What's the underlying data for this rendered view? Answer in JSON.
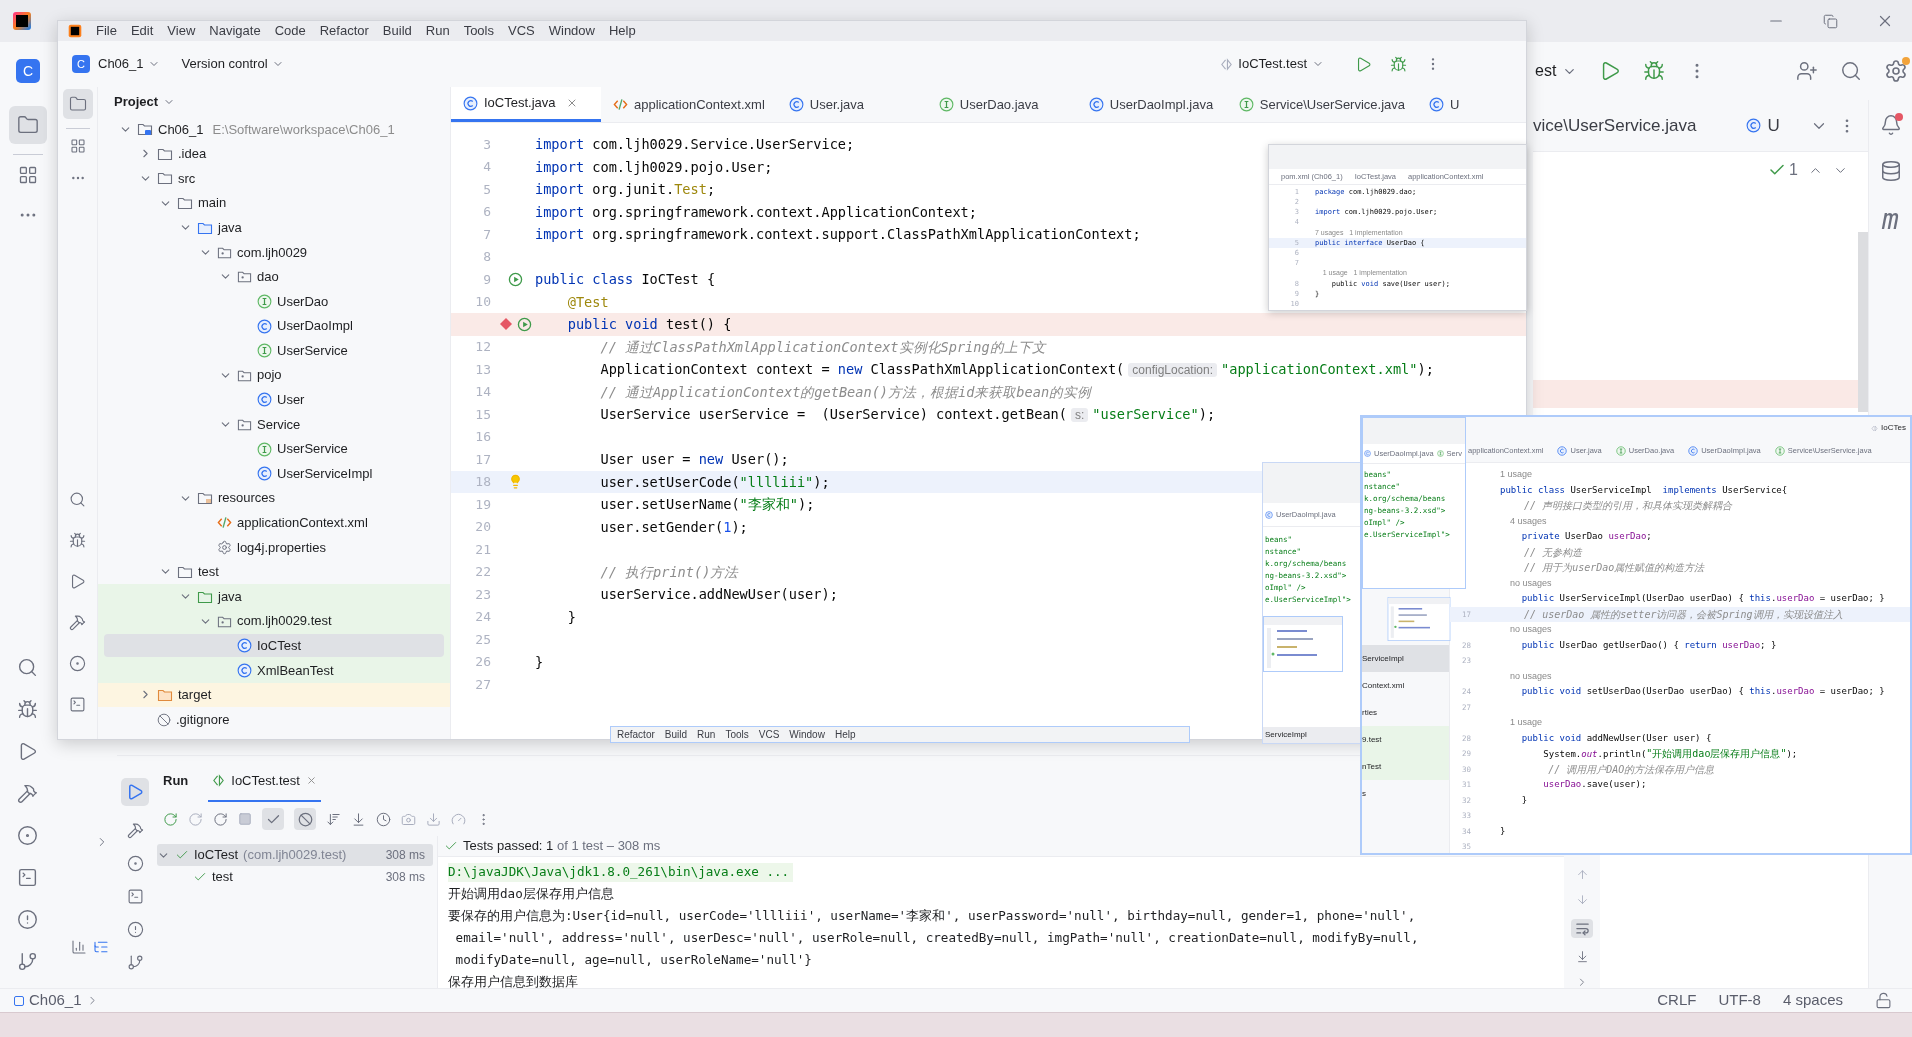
{
  "back_window": {
    "project_badge": "C",
    "run_config": "est",
    "tabs": [
      {
        "label": "vice\\UserService.java",
        "selected": false
      },
      {
        "label": "U",
        "kind": "class",
        "selected": false
      }
    ],
    "inspection_count": "1",
    "maven_label": "m",
    "status_bar": {
      "project": "Ch06_1",
      "items": [
        "CRLF",
        "UTF-8",
        "4 spaces"
      ]
    }
  },
  "run_panel": {
    "title": "Run",
    "tabs": [
      {
        "label": "IoCTest.test",
        "selected": true
      }
    ],
    "tests": [
      {
        "label": "IoCTest",
        "detail": "(com.ljh0029.test)",
        "time": "308 ms",
        "selected": true,
        "expanded": true,
        "children": [
          {
            "label": "test",
            "time": "308 ms",
            "selected": false
          }
        ]
      }
    ],
    "status": "**Tests passed: 1** of 1 test – 308 ms",
    "console": [
      {
        "kind": "command",
        "text": "D:\\javaJDK\\Java\\jdk1.8.0_261\\bin\\java.exe ..."
      },
      {
        "kind": "output",
        "text": "开始调用dao层保存用户信息"
      },
      {
        "kind": "output",
        "text": "要保存的用户信息为:User{id=null, userCode='lllliii', userName='李家和', userPassword='null', birthday=null, gender=1, phone='null',"
      },
      {
        "kind": "output",
        "text": " email='null', address='null', userDesc='null', userRole=null, createdBy=null, imgPath='null', creationDate=null, modifyBy=null,"
      },
      {
        "kind": "output",
        "text": " modifyDate=null, age=null, userRoleName='null'}"
      },
      {
        "kind": "output",
        "text": "保存用户信息到数据库"
      }
    ]
  },
  "front_window": {
    "menu": [
      "File",
      "Edit",
      "View",
      "Navigate",
      "Code",
      "Refactor",
      "Build",
      "Run",
      "Tools",
      "VCS",
      "Window",
      "Help"
    ],
    "project_badge": "C",
    "project": "Ch06_1",
    "vcs": "Version control",
    "run_config": "IoCTest.test",
    "panel_title": "Project",
    "tree": [
      {
        "label": "Ch06_1",
        "path": "E:\\Software\\workspace\\Ch06_1",
        "kind": "module",
        "expanded": true,
        "selected": false,
        "children": [
          {
            "label": ".idea",
            "kind": "folder",
            "expanded": false,
            "selected": false
          },
          {
            "label": "src",
            "kind": "folder",
            "expanded": true,
            "selected": false,
            "children": [
              {
                "label": "main",
                "kind": "folder",
                "expanded": true,
                "selected": false,
                "children": [
                  {
                    "label": "java",
                    "kind": "source_root",
                    "expanded": true,
                    "selected": false,
                    "children": [
                      {
                        "label": "com.ljh0029",
                        "kind": "package",
                        "expanded": true,
                        "selected": false,
                        "children": [
                          {
                            "label": "dao",
                            "kind": "package",
                            "expanded": true,
                            "selected": false,
                            "children": [
                              {
                                "label": "UserDao",
                                "kind": "interface",
                                "selected": false
                              },
                              {
                                "label": "UserDaoImpl",
                                "kind": "class",
                                "selected": false
                              },
                              {
                                "label": "UserService",
                                "kind": "interface",
                                "selected": false
                              }
                            ]
                          },
                          {
                            "label": "pojo",
                            "kind": "package",
                            "expanded": true,
                            "selected": false,
                            "children": [
                              {
                                "label": "User",
                                "kind": "class",
                                "selected": false
                              }
                            ]
                          },
                          {
                            "label": "Service",
                            "kind": "package",
                            "expanded": true,
                            "selected": false,
                            "children": [
                              {
                                "label": "UserService",
                                "kind": "interface",
                                "selected": false
                              },
                              {
                                "label": "UserServiceImpl",
                                "kind": "class",
                                "selected": false
                              }
                            ]
                          }
                        ]
                      }
                    ]
                  },
                  {
                    "label": "resources",
                    "kind": "resources",
                    "expanded": true,
                    "selected": false,
                    "children": [
                      {
                        "label": "applicationContext.xml",
                        "kind": "xml",
                        "selected": false
                      },
                      {
                        "label": "log4j.properties",
                        "kind": "properties",
                        "selected": false
                      }
                    ]
                  }
                ]
              },
              {
                "label": "test",
                "kind": "folder",
                "expanded": true,
                "selected": false,
                "children": [
                  {
                    "label": "java",
                    "kind": "test_root",
                    "expanded": true,
                    "selected": false,
                    "children": [
                      {
                        "label": "com.ljh0029.test",
                        "kind": "package",
                        "expanded": true,
                        "selected": false,
                        "children": [
                          {
                            "label": "IoCTest",
                            "kind": "class",
                            "selected": true
                          },
                          {
                            "label": "XmlBeanTest",
                            "kind": "class",
                            "selected": false
                          }
                        ]
                      }
                    ]
                  }
                ]
              }
            ]
          },
          {
            "label": "target",
            "kind": "excluded",
            "expanded": false,
            "selected": false
          },
          {
            "label": ".gitignore",
            "kind": "ignore",
            "selected": false
          }
        ]
      }
    ],
    "tabs": [
      {
        "label": "IoCTest.java",
        "kind": "class",
        "selected": true
      },
      {
        "label": "applicationContext.xml",
        "kind": "xml",
        "selected": false
      },
      {
        "label": "User.java",
        "kind": "class",
        "selected": false
      },
      {
        "label": "UserDao.java",
        "kind": "interface",
        "selected": false
      },
      {
        "label": "UserDaoImpl.java",
        "kind": "class",
        "selected": false
      },
      {
        "label": "Service\\UserService.java",
        "kind": "interface",
        "selected": false
      },
      {
        "label": "U",
        "kind": "class",
        "selected": false
      }
    ],
    "code": [
      {
        "n": "3",
        "segs": [
          {
            "kind": "kw",
            "text": "import"
          },
          {
            "kind": "pl",
            "text": " com.ljh0029.Service.UserService;"
          }
        ]
      },
      {
        "n": "4",
        "segs": [
          {
            "kind": "kw",
            "text": "import"
          },
          {
            "kind": "pl",
            "text": " com.ljh0029.pojo.User;"
          }
        ]
      },
      {
        "n": "5",
        "segs": [
          {
            "kind": "kw",
            "text": "import"
          },
          {
            "kind": "pl",
            "text": " org.junit."
          },
          {
            "kind": "ann",
            "text": "Test"
          },
          {
            "kind": "pl",
            "text": ";"
          }
        ]
      },
      {
        "n": "6",
        "segs": [
          {
            "kind": "kw",
            "text": "import"
          },
          {
            "kind": "pl",
            "text": " org.springframework.context.ApplicationContext;"
          }
        ]
      },
      {
        "n": "7",
        "segs": [
          {
            "kind": "kw",
            "text": "import"
          },
          {
            "kind": "pl",
            "text": " org.springframework.context.support.ClassPathXmlApplicationContext;"
          }
        ]
      },
      {
        "n": "8"
      },
      {
        "n": "9",
        "run_gutter": true,
        "segs": [
          {
            "kind": "kw",
            "text": "public class"
          },
          {
            "kind": "pl",
            "text": " IoCTest {"
          }
        ]
      },
      {
        "n": "10",
        "segs": [
          {
            "kind": "ann",
            "text": "    @Test"
          }
        ]
      },
      {
        "breakpoint": true,
        "run_gutter": true,
        "segs": [
          {
            "kind": "kw",
            "text": "    public void"
          },
          {
            "kind": "pl",
            "text": " test() {"
          }
        ]
      },
      {
        "n": "12",
        "segs": [
          {
            "kind": "com",
            "text": "        // 通过ClassPathXmlApplicationContext实例化Spring的上下文"
          }
        ]
      },
      {
        "n": "13",
        "segs": [
          {
            "kind": "pl",
            "text": "        ApplicationContext context = "
          },
          {
            "kind": "kw",
            "text": "new"
          },
          {
            "kind": "pl",
            "text": " ClassPathXmlApplicationContext("
          },
          {
            "kind": "hint",
            "text": "configLocation:"
          },
          {
            "kind": "str",
            "text": "\"applicationContext.xml\""
          },
          {
            "kind": "pl",
            "text": ");"
          }
        ]
      },
      {
        "n": "14",
        "segs": [
          {
            "kind": "com",
            "text": "        // 通过ApplicationContext的getBean()方法，根据id来获取bean的实例"
          }
        ]
      },
      {
        "n": "15",
        "segs": [
          {
            "kind": "pl",
            "text": "        UserService userService =  (UserService) context.getBean("
          },
          {
            "kind": "hint",
            "text": "s:"
          },
          {
            "kind": "str",
            "text": "\"userService\""
          },
          {
            "kind": "pl",
            "text": ");"
          }
        ]
      },
      {
        "n": "16"
      },
      {
        "n": "17",
        "segs": [
          {
            "kind": "pl",
            "text": "        User user = "
          },
          {
            "kind": "kw",
            "text": "new"
          },
          {
            "kind": "pl",
            "text": " User();"
          }
        ]
      },
      {
        "n": "18",
        "current": true,
        "bulb": true,
        "segs": [
          {
            "kind": "pl",
            "text": "        user.setUserCode("
          },
          {
            "kind": "str",
            "text": "\"lllliii\""
          },
          {
            "kind": "pl",
            "text": ");"
          }
        ]
      },
      {
        "n": "19",
        "segs": [
          {
            "kind": "pl",
            "text": "        user.setUserName("
          },
          {
            "kind": "str",
            "text": "\"李家和\""
          },
          {
            "kind": "pl",
            "text": ");"
          }
        ]
      },
      {
        "n": "20",
        "segs": [
          {
            "kind": "pl",
            "text": "        user.setGender("
          },
          {
            "kind": "num",
            "text": "1"
          },
          {
            "kind": "pl",
            "text": ");"
          }
        ]
      },
      {
        "n": "21"
      },
      {
        "n": "22",
        "segs": [
          {
            "kind": "com",
            "text": "        // 执行print()方法"
          }
        ]
      },
      {
        "n": "23",
        "segs": [
          {
            "kind": "pl",
            "text": "        userService.addNewUser(user);"
          }
        ]
      },
      {
        "n": "24",
        "segs": [
          {
            "kind": "pl",
            "text": "    }"
          }
        ]
      },
      {
        "n": "25"
      },
      {
        "n": "26",
        "segs": [
          {
            "kind": "pl",
            "text": "}"
          }
        ]
      },
      {
        "n": "27"
      }
    ]
  },
  "preview_popup": {
    "tabs": [
      "pom.xml (Ch06_1)",
      "IoCTest.java",
      "applicationContext.xml"
    ],
    "code": [
      {
        "n": "1",
        "segs": [
          {
            "kind": "kw",
            "text": "package"
          },
          {
            "kind": "pl",
            "text": " com.ljh0029.dao;"
          }
        ]
      },
      {
        "n": "2"
      },
      {
        "n": "3",
        "segs": [
          {
            "kind": "kw",
            "text": "import"
          },
          {
            "kind": "pl",
            "text": " com.ljh0029.pojo.User;"
          }
        ]
      },
      {
        "n": "4"
      },
      {
        "segs": [
          {
            "kind": "usage",
            "text": "7 usages   1 implementation"
          }
        ]
      },
      {
        "n": "5",
        "current": true,
        "segs": [
          {
            "kind": "kw",
            "text": "public interface"
          },
          {
            "kind": "pl",
            "text": " UserDao {"
          }
        ]
      },
      {
        "n": "6"
      },
      {
        "n": "7"
      },
      {
        "segs": [
          {
            "kind": "usage",
            "text": "    1 usage   1 implementation"
          }
        ]
      },
      {
        "n": "8",
        "segs": [
          {
            "kind": "pl",
            "text": "    public "
          },
          {
            "kind": "kw",
            "text": "void"
          },
          {
            "kind": "pl",
            "text": " save(User user);"
          }
        ]
      },
      {
        "n": "9",
        "segs": [
          {
            "kind": "pl",
            "text": "}"
          }
        ]
      },
      {
        "n": "10"
      }
    ]
  },
  "ghost_panel": {
    "tab": "UserDaoImpl.java",
    "lines": [
      "beans\"",
      "nstance\"",
      "k.org/schema/beans",
      "ng-beans-3.2.xsd\">",
      "oImpl\" />",
      "e.UserServiceImpl\">"
    ],
    "footer": "ServiceImpl"
  },
  "overlay_window": {
    "run_config": "IoCTes",
    "popup": {
      "tabs": [
        "UserDaoImpl.java",
        "Serv"
      ],
      "lines": [
        "beans\"",
        "nstance\"",
        "k.org/schema/beans",
        "ng-beans-3.2.xsd\">",
        "oImpl\" />",
        "e.UserServiceImpl\">"
      ]
    },
    "list": [
      {
        "label": "ServiceImpl",
        "selected": true,
        "tinted": false
      },
      {
        "label": "Context.xml",
        "selected": false,
        "tinted": false
      },
      {
        "label": "rties",
        "selected": false,
        "tinted": false
      },
      {
        "label": "9.test",
        "selected": false,
        "tinted": true
      },
      {
        "label": "nTest",
        "selected": false,
        "tinted": true
      },
      {
        "label": "s",
        "selected": false,
        "tinted": false
      }
    ],
    "tabs": [
      {
        "label": "applicationContext.xml",
        "selected": false
      },
      {
        "label": "User.java",
        "kind": "class",
        "selected": false
      },
      {
        "label": "UserDao.java",
        "kind": "interface",
        "selected": false
      },
      {
        "label": "UserDaoImpl.java",
        "kind": "class",
        "selected": false
      },
      {
        "label": "Service\\UserService.java",
        "kind": "interface",
        "selected": false
      }
    ],
    "code": [
      {
        "segs": [
          {
            "kind": "usage",
            "text": "1 usage"
          }
        ]
      },
      {
        "segs": [
          {
            "kind": "kw",
            "text": "public class"
          },
          {
            "kind": "pl",
            "text": " UserServiceImpl  "
          },
          {
            "kind": "kw",
            "text": "implements"
          },
          {
            "kind": "pl",
            "text": " UserService{"
          }
        ]
      },
      {
        "segs": [
          {
            "kind": "com",
            "text": "    // 声明接口类型的引用，和具体实现类解耦合"
          }
        ]
      },
      {
        "segs": [
          {
            "kind": "usage",
            "text": "    4 usages"
          }
        ]
      },
      {
        "segs": [
          {
            "kind": "kw",
            "text": "    private"
          },
          {
            "kind": "pl",
            "text": " UserDao "
          },
          {
            "kind": "fld",
            "text": "userDao"
          },
          {
            "kind": "pl",
            "text": ";"
          }
        ]
      },
      {
        "segs": [
          {
            "kind": "com",
            "text": "    // 无参构造"
          }
        ]
      },
      {
        "segs": [
          {
            "kind": "com",
            "text": "    // 用于为userDao属性赋值的构造方法"
          }
        ]
      },
      {
        "segs": [
          {
            "kind": "usage",
            "text": "    no usages"
          }
        ]
      },
      {
        "segs": [
          {
            "kind": "kw",
            "text": "    public"
          },
          {
            "kind": "pl",
            "text": " UserServiceImpl(UserDao userDao) { "
          },
          {
            "kind": "kw",
            "text": "this"
          },
          {
            "kind": "pl",
            "text": "."
          },
          {
            "kind": "fld",
            "text": "userDao"
          },
          {
            "kind": "pl",
            "text": " = userDao; }"
          }
        ]
      },
      {
        "n": "17",
        "current": true,
        "segs": [
          {
            "kind": "com",
            "text": "    // userDao 属性的setter访问器，会被Spring调用，实现设值注入"
          }
        ]
      },
      {
        "segs": [
          {
            "kind": "usage",
            "text": "    no usages"
          }
        ]
      },
      {
        "n": "28",
        "segs": [
          {
            "kind": "kw",
            "text": "    public"
          },
          {
            "kind": "pl",
            "text": " UserDao getUserDao() { "
          },
          {
            "kind": "kw",
            "text": "return "
          },
          {
            "kind": "fld",
            "text": "userDao"
          },
          {
            "kind": "pl",
            "text": "; }"
          }
        ]
      },
      {
        "n": "23"
      },
      {
        "segs": [
          {
            "kind": "usage",
            "text": "    no usages"
          }
        ]
      },
      {
        "n": "24",
        "segs": [
          {
            "kind": "kw",
            "text": "    public void"
          },
          {
            "kind": "pl",
            "text": " setUserDao(UserDao userDao) { "
          },
          {
            "kind": "kw",
            "text": "this"
          },
          {
            "kind": "pl",
            "text": "."
          },
          {
            "kind": "fld",
            "text": "userDao"
          },
          {
            "kind": "pl",
            "text": " = userDao; }"
          }
        ]
      },
      {
        "n": "27"
      },
      {
        "segs": [
          {
            "kind": "usage",
            "text": "    1 usage"
          }
        ]
      },
      {
        "n": "28",
        "segs": [
          {
            "kind": "kw",
            "text": "    public void"
          },
          {
            "kind": "pl",
            "text": " addNewUser(User user) {"
          }
        ]
      },
      {
        "n": "29",
        "segs": [
          {
            "kind": "pl",
            "text": "        System."
          },
          {
            "kind": "st",
            "text": "out"
          },
          {
            "kind": "pl",
            "text": ".println("
          },
          {
            "kind": "str",
            "text": "\"开始调用dao层保存用户信息\""
          },
          {
            "kind": "pl",
            "text": ");"
          }
        ]
      },
      {
        "n": "30",
        "segs": [
          {
            "kind": "com",
            "text": "        // 调用用户DAO的方法保存用户信息"
          }
        ]
      },
      {
        "n": "31",
        "segs": [
          {
            "kind": "fld",
            "text": "        userDao"
          },
          {
            "kind": "pl",
            "text": ".save(user);"
          }
        ]
      },
      {
        "n": "32",
        "segs": [
          {
            "kind": "pl",
            "text": "    }"
          }
        ]
      },
      {
        "n": "33"
      },
      {
        "n": "34",
        "segs": [
          {
            "kind": "pl",
            "text": "}"
          }
        ]
      },
      {
        "n": "35"
      }
    ]
  },
  "floating_menu": [
    "Refactor",
    "Build",
    "Run",
    "Tools",
    "VCS",
    "Window",
    "Help"
  ]
}
